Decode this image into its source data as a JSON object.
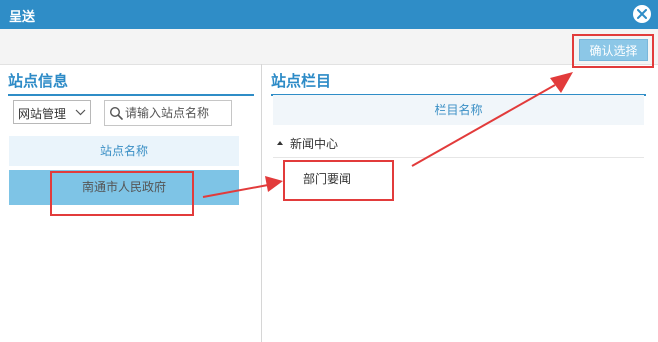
{
  "dialog": {
    "title": "呈送",
    "close_label": "×"
  },
  "toolbar": {
    "confirm_label": "确认选择"
  },
  "left_panel": {
    "heading": "站点信息",
    "select_value": "网站管理",
    "search_placeholder": "请输入站点名称",
    "column_header": "站点名称",
    "rows": [
      {
        "name": "南通市人民政府",
        "selected": true
      }
    ]
  },
  "right_panel": {
    "heading": "站点栏目",
    "column_header": "栏目名称",
    "tree": [
      {
        "label": "新闻中心",
        "expanded": true,
        "children": [
          {
            "label": "部门要闻"
          }
        ]
      }
    ]
  },
  "colors": {
    "accent": "#2f8dc7",
    "selected_row": "#7ec4e6",
    "annotation": "#e23b3b"
  },
  "icons": {
    "close": "close-icon",
    "search": "search-icon",
    "dropdown": "chevron-down-icon",
    "tree_expanded": "caret-down-icon"
  }
}
